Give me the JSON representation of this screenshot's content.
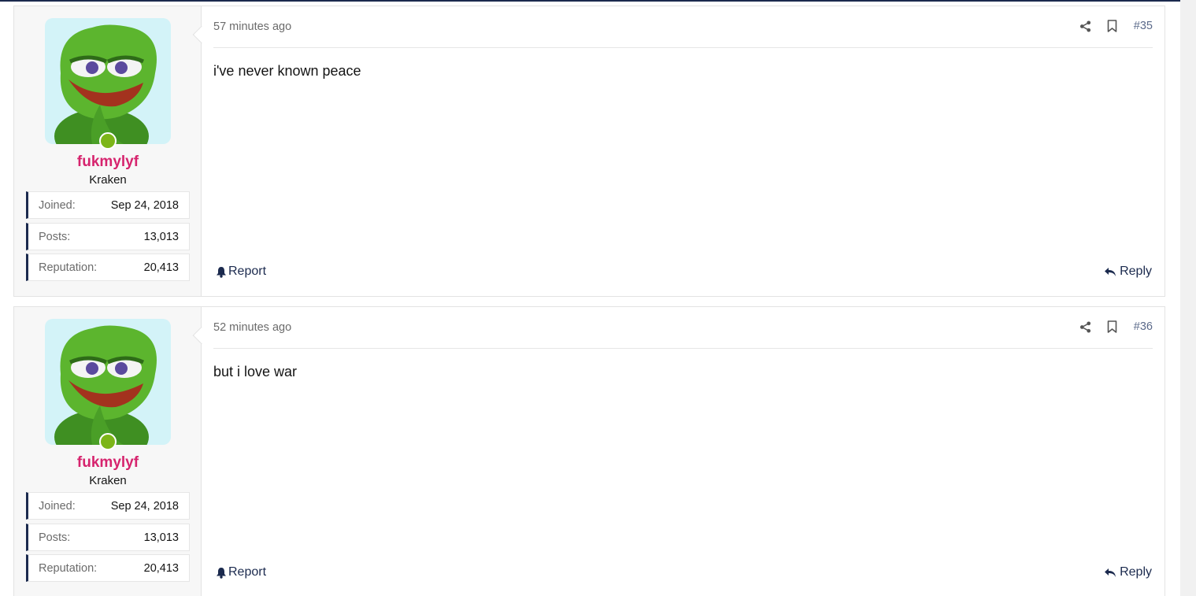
{
  "colors": {
    "accent": "#1b2a4e",
    "username": "#d6246e",
    "online": "#7cb518"
  },
  "posts": [
    {
      "time": "57 minutes ago",
      "number": "#35",
      "body": "i've never known peace",
      "user": {
        "name": "fukmylyf",
        "title": "Kraken",
        "avatar": "pepe-avatar"
      },
      "stats": [
        {
          "label": "Joined:",
          "value": "Sep 24, 2018"
        },
        {
          "label": "Posts:",
          "value": "13,013"
        },
        {
          "label": "Reputation:",
          "value": "20,413"
        }
      ],
      "actions": {
        "report": "Report",
        "reply": "Reply"
      }
    },
    {
      "time": "52 minutes ago",
      "number": "#36",
      "body": "but i love war",
      "user": {
        "name": "fukmylyf",
        "title": "Kraken",
        "avatar": "pepe-avatar"
      },
      "stats": [
        {
          "label": "Joined:",
          "value": "Sep 24, 2018"
        },
        {
          "label": "Posts:",
          "value": "13,013"
        },
        {
          "label": "Reputation:",
          "value": "20,413"
        }
      ],
      "actions": {
        "report": "Report",
        "reply": "Reply"
      }
    }
  ]
}
